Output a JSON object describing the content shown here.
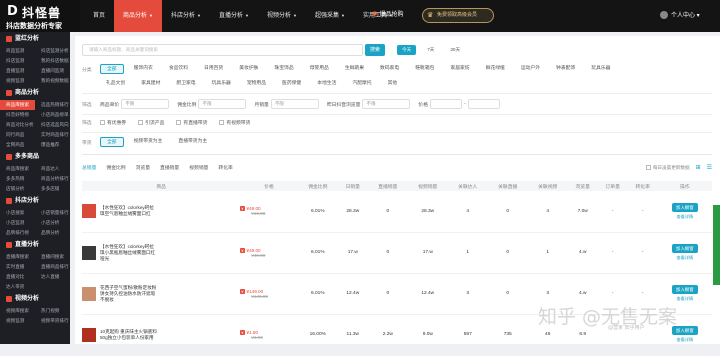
{
  "brand": {
    "mark": "D",
    "name": "抖怪兽",
    "slogan": "抖店数据分析专家"
  },
  "nav": [
    {
      "label": "首页",
      "active": false,
      "caret": false
    },
    {
      "label": "商品分析",
      "active": true,
      "caret": true
    },
    {
      "label": "抖店分析",
      "active": false,
      "caret": true
    },
    {
      "label": "直播分析",
      "active": false,
      "caret": true
    },
    {
      "label": "视频分析",
      "active": false,
      "caret": true
    },
    {
      "label": "超强采集",
      "active": false,
      "caret": true
    },
    {
      "label": "实用工具",
      "active": false,
      "caret": true
    }
  ],
  "hot_label": "爆品抢购",
  "vip_label": "免费领取高级会员",
  "user_label": "个人中心",
  "sidebar": [
    {
      "title": "蓝红分析",
      "rows": [
        [
          "商品监测",
          "抖店监测分析"
        ],
        [
          "抖店监测",
          "我的抖店数据"
        ],
        [
          "直播监测",
          "直播间监测"
        ],
        [
          "视频监测",
          "我的视频数据"
        ]
      ]
    },
    {
      "title": "商品分析",
      "rows": [
        [
          "商品库搜索",
          "选品热销排行"
        ],
        [
          "抖音好物榜",
          "小店商品榜单"
        ],
        [
          "商品对比分析",
          "抖店选品风向"
        ],
        [
          "同行商品",
          "实时商品排行"
        ],
        [
          "全网商品",
          "爆品推荐"
        ]
      ]
    },
    {
      "title": "多多商品",
      "rows": [
        [
          "商品库搜索",
          "商品达人"
        ],
        [
          "多多热销",
          "商品分析排行"
        ],
        [
          "店铺分析",
          "多多店铺"
        ]
      ]
    },
    {
      "title": "抖店分析",
      "rows": [
        [
          "小店搜索",
          "小店销量排行"
        ],
        [
          "小店监测",
          "小店分析"
        ],
        [
          "品牌排行榜",
          "品牌分析"
        ]
      ]
    },
    {
      "title": "直播分析",
      "rows": [
        [
          "直播库搜索",
          "直播间搜索"
        ],
        [
          "实时直播",
          "直播商品排行"
        ],
        [
          "直播对比",
          "达人直播"
        ],
        [
          "达人带货",
          ""
        ]
      ]
    },
    {
      "title": "视频分析",
      "rows": [
        [
          "视频库搜索",
          "热门视频"
        ],
        [
          "视频监测",
          "视频带货排行"
        ]
      ]
    }
  ],
  "search": {
    "placeholder": "请输入商品标题、商品关键词搜索",
    "button": "搜索",
    "ranges": [
      "今天",
      "7天",
      "30天"
    ]
  },
  "filters": {
    "category_label": "分类",
    "categories_row1": [
      "全部",
      "服饰内衣",
      "食品饮料",
      "日用百货",
      "美妆护肤",
      "珠宝饰品",
      "母婴用品",
      "生鲜蔬果",
      "数码家电",
      "鞋靴箱包",
      "家居家纺",
      "鲜花绿植",
      "运动户外",
      "钟表配饰",
      "玩具乐器"
    ],
    "categories_row2": [
      "礼品文创",
      "家具建材",
      "厨卫家电",
      "玩具乐器",
      "宠物用品",
      "医药保健",
      "本地生活",
      "汽配摩托",
      "其他"
    ],
    "ranges_label": "筛选",
    "ranges": [
      {
        "label": "商品单价",
        "value": "不限"
      },
      {
        "label": "佣金比例",
        "value": "不限"
      },
      {
        "label": "月销量",
        "value": "不限"
      },
      {
        "label": "昨日抖音浏览量",
        "value": "不限"
      }
    ],
    "custom_label": "价格",
    "options_label": "筛选",
    "options": [
      "有优惠券",
      "引流产品",
      "有直播带货",
      "有视频带货"
    ],
    "source_label": "带货",
    "sources": [
      "全部",
      "视频带货为主",
      "直播带货为主"
    ]
  },
  "sort_tabs": {
    "items": [
      "总销量",
      "佣金比例",
      "浏览量",
      "直播销量",
      "视频销量",
      "转化率"
    ],
    "right_label": "每日凌晨更新数据",
    "active_index": 0
  },
  "table": {
    "headers": [
      "商品",
      "价格",
      "佣金比例",
      "日销量",
      "直播销量",
      "视频销量",
      "关联达人",
      "关联直播",
      "关联视频",
      "浏览量",
      "订单量",
      "转化率",
      "操作"
    ],
    "rows": [
      {
        "name": "【水性狂欢】colorkey珂拉琪空气唇釉丝绒雾面口红",
        "price": "¥49.00",
        "old_price": "¥49.00",
        "commission": "6.01%",
        "daily": "28.3w",
        "live": "0",
        "video": "28.3w",
        "talents": "4",
        "lives": "0",
        "videos": "4",
        "views": "7.0w",
        "orders": "-",
        "conversion": "-",
        "op1": "加入橱窗",
        "op2": "查看详情",
        "thumb": "#d84a3a"
      },
      {
        "name": "【水性狂欢】colorkey珂拉琪小黑瓶唇釉丝绒雾面口红哑光",
        "price": "¥49.00",
        "old_price": "¥49.00",
        "commission": "6.01%",
        "daily": "17.w",
        "live": "0",
        "video": "17.w",
        "talents": "1",
        "lives": "0",
        "videos": "1",
        "views": "4.w",
        "orders": "-",
        "conversion": "-",
        "op1": "加入橱窗",
        "op2": "查看详情",
        "thumb": "#3a3a3a"
      },
      {
        "name": "花西子空气蜜粉/散粉定妆粉饼女持久控油防水防汗遮瑕不脱妆",
        "price": "¥149.00",
        "old_price": "¥149.00",
        "commission": "6.01%",
        "daily": "12.4w",
        "live": "0",
        "video": "12.4w",
        "talents": "3",
        "lives": "0",
        "videos": "3",
        "views": "4.w",
        "orders": "-",
        "conversion": "-",
        "op1": "加入橱窗",
        "op2": "查看详情",
        "thumb": "#c98f6e"
      },
      {
        "name": "10克起购 重庆味主火锅底料50g独立小包装单人份家用",
        "price": "¥1.90",
        "old_price": "¥1.90",
        "commission": "16.00%",
        "daily": "11.3w",
        "live": "2.2w",
        "video": "9.0w",
        "talents": "597",
        "lives": "735",
        "videos": "46",
        "views": "6.9",
        "orders": "",
        "conversion": "",
        "op1": "加入橱窗",
        "op2": "查看详情",
        "thumb": "#b03020"
      }
    ]
  },
  "watermark": {
    "text": "知乎 @无售无案",
    "small": "@营家 知乎用户"
  }
}
